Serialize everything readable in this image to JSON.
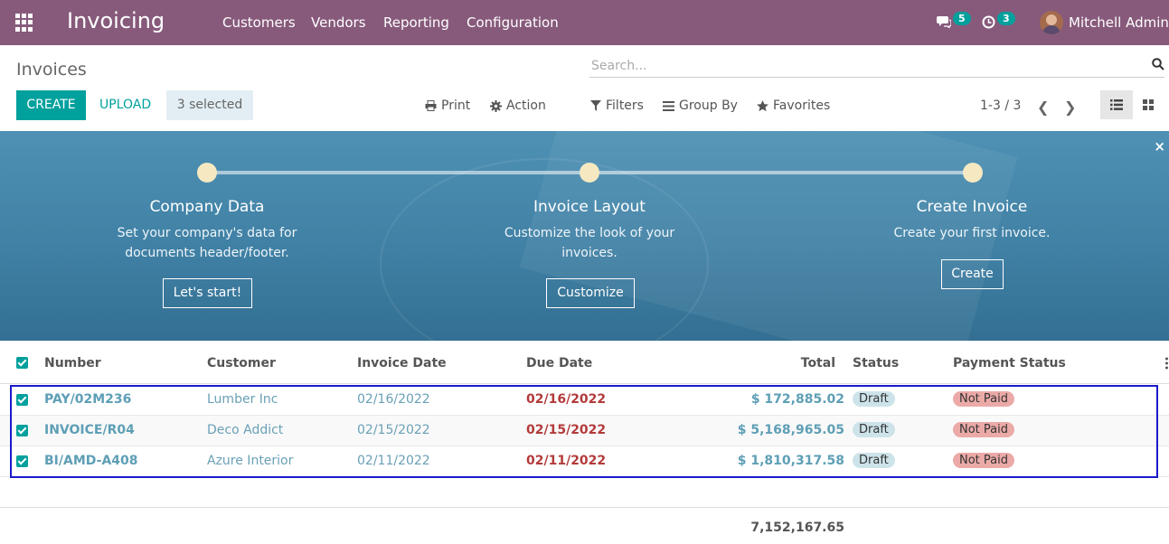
{
  "navbar": {
    "app_title": "Invoicing",
    "menu": [
      "Customers",
      "Vendors",
      "Reporting",
      "Configuration"
    ],
    "messages_count": "5",
    "activities_count": "3",
    "user_name": "Mitchell Admin"
  },
  "control": {
    "page_title": "Invoices",
    "search_placeholder": "Search...",
    "create_label": "CREATE",
    "upload_label": "UPLOAD",
    "selected_label": "3 selected",
    "print_label": "Print",
    "action_label": "Action",
    "filters_label": "Filters",
    "groupby_label": "Group By",
    "favorites_label": "Favorites",
    "pager": "1-3 / 3"
  },
  "banner": {
    "steps": [
      {
        "title": "Company Data",
        "desc1": "Set your company's data for",
        "desc2": "documents header/footer.",
        "button": "Let's start!"
      },
      {
        "title": "Invoice Layout",
        "desc1": "Customize the look of your",
        "desc2": "invoices.",
        "button": "Customize"
      },
      {
        "title": "Create Invoice",
        "desc1": "Create your first invoice.",
        "desc2": "",
        "button": "Create"
      }
    ],
    "close": "×"
  },
  "table": {
    "headers": {
      "number": "Number",
      "customer": "Customer",
      "invoice_date": "Invoice Date",
      "due_date": "Due Date",
      "total": "Total",
      "status": "Status",
      "payment_status": "Payment Status"
    },
    "rows": [
      {
        "number": "PAY/02M236",
        "customer": "Lumber Inc",
        "invoice_date": "02/16/2022",
        "due_date": "02/16/2022",
        "total": "$ 172,885.02",
        "status": "Draft",
        "payment_status": "Not Paid"
      },
      {
        "number": "INVOICE/R04",
        "customer": "Deco Addict",
        "invoice_date": "02/15/2022",
        "due_date": "02/15/2022",
        "total": "$ 5,168,965.05",
        "status": "Draft",
        "payment_status": "Not Paid"
      },
      {
        "number": "BI/AMD-A408",
        "customer": "Azure Interior",
        "invoice_date": "02/11/2022",
        "due_date": "02/11/2022",
        "total": "$ 1,810,317.58",
        "status": "Draft",
        "payment_status": "Not Paid"
      }
    ],
    "grand_total": "7,152,167.65"
  }
}
